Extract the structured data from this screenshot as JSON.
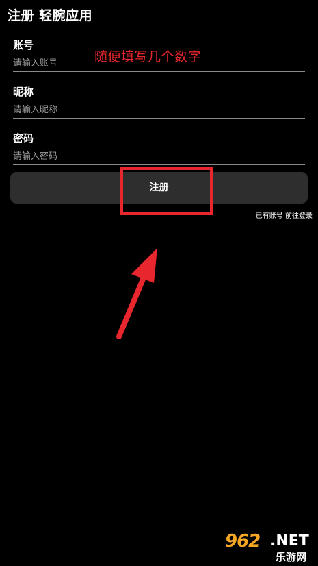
{
  "header": {
    "title": "注册 轻腕应用"
  },
  "form": {
    "account": {
      "label": "账号",
      "placeholder": "请输入账号",
      "value": ""
    },
    "nickname": {
      "label": "昵称",
      "placeholder": "请输入昵称",
      "value": ""
    },
    "password": {
      "label": "密码",
      "placeholder": "请输入密码",
      "value": ""
    },
    "submit_label": "注册",
    "login_link": "已有账号 前往登录"
  },
  "annotation": {
    "hint": "随便填写几个数字",
    "color": "#e8262d"
  },
  "watermark": {
    "number": "962",
    "domain": ".NET",
    "name": "乐游网"
  },
  "colors": {
    "background": "#000000",
    "button": "#2e2e2e",
    "accent": "#e8262d",
    "watermark_orange": "#f5a623"
  }
}
